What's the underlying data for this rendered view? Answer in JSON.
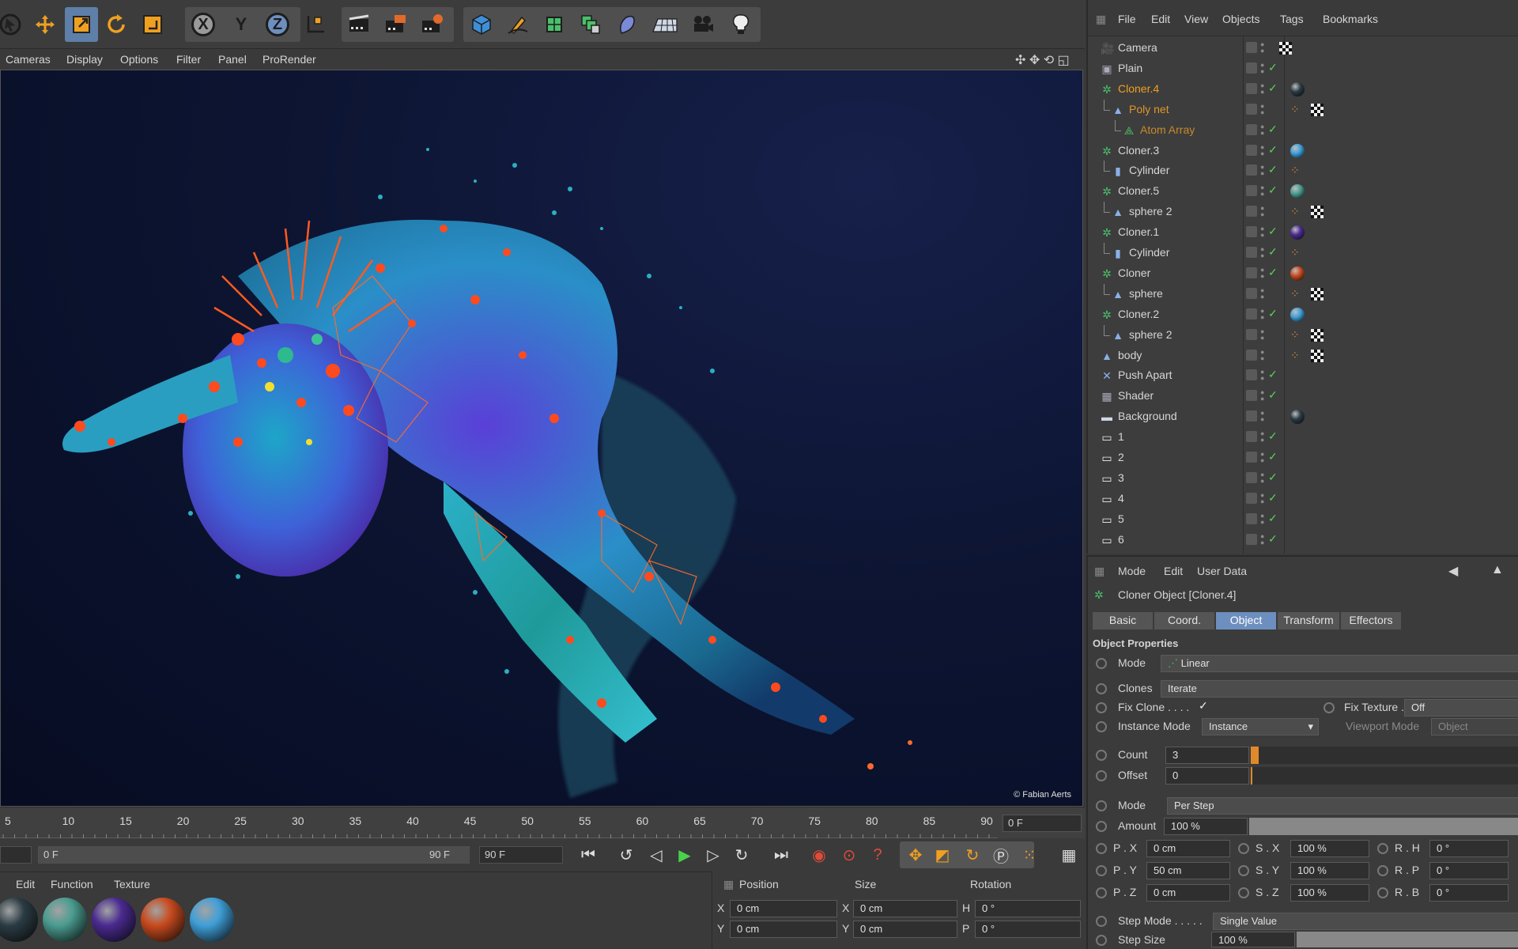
{
  "toolbar": {
    "icons": [
      "cursor-icon",
      "move-icon",
      "scale-icon",
      "rotate-icon",
      "last-tool-icon",
      "x-axis-icon",
      "y-axis-icon",
      "z-axis-icon",
      "world-coord-icon",
      "render-view-icon",
      "render-picture-viewer-icon",
      "render-settings-icon",
      "cube-icon",
      "pen-icon",
      "subdivision-icon",
      "array-icon",
      "deformer-icon",
      "floor-icon",
      "camera-icon",
      "light-icon"
    ],
    "axis_x": "X",
    "axis_y": "Y",
    "axis_z": "Z"
  },
  "viewport_menu": {
    "cameras": "Cameras",
    "display": "Display",
    "options": "Options",
    "filter": "Filter",
    "panel": "Panel",
    "prorender": "ProRender"
  },
  "viewport": {
    "credit": "© Fabian Aerts"
  },
  "timeline": {
    "ticks": [
      "5",
      "10",
      "15",
      "20",
      "25",
      "30",
      "35",
      "40",
      "45",
      "50",
      "55",
      "60",
      "65",
      "70",
      "75",
      "80",
      "85",
      "90"
    ],
    "current_frame": "0 F",
    "range_start": "0 F",
    "range_end": "90 F",
    "max_frame": "90 F"
  },
  "materials_menu": {
    "edit": "Edit",
    "function": "Function",
    "texture": "Texture"
  },
  "materials": [
    {
      "color": "#2b3c44"
    },
    {
      "color": "#4a9c90"
    },
    {
      "color": "#4a2a90"
    },
    {
      "color": "#c84a1e"
    },
    {
      "color": "#3f9fd8"
    }
  ],
  "coord": {
    "position": "Position",
    "size": "Size",
    "rotation": "Rotation",
    "px_label": "X",
    "px": "0 cm",
    "py_label": "Y",
    "py": "0 cm",
    "sx_label": "X",
    "sx": "0 cm",
    "sy_label": "Y",
    "sy": "0 cm",
    "rh_label": "H",
    "rh": "0 °",
    "rp_label": "P",
    "rp": "0 °"
  },
  "object_manager": {
    "menu": {
      "file": "File",
      "edit": "Edit",
      "view": "View",
      "objects": "Objects",
      "tags": "Tags",
      "bookmarks": "Bookmarks"
    },
    "rows": [
      {
        "name": "Camera",
        "indent": 0,
        "color": "#d6d6d6",
        "icon": "camera-icon",
        "tags": [
          "checker-small"
        ]
      },
      {
        "name": "Plain",
        "indent": 0,
        "color": "#d6d6d6",
        "icon": "plain-effector-icon",
        "tags": []
      },
      {
        "name": "Cloner.4",
        "indent": 0,
        "color": "#f0a020",
        "icon": "cloner-icon",
        "tags": [
          "sphere-dark"
        ]
      },
      {
        "name": "Poly net",
        "indent": 1,
        "color": "#e0962a",
        "icon": "polygon-icon",
        "tags": [
          "phong",
          "checker"
        ]
      },
      {
        "name": "Atom Array",
        "indent": 2,
        "color": "#c98a2a",
        "icon": "atom-array-icon",
        "tags": []
      },
      {
        "name": "Cloner.3",
        "indent": 0,
        "color": "#d6d6d6",
        "icon": "cloner-icon",
        "tags": [
          "sphere-blue"
        ]
      },
      {
        "name": "Cylinder",
        "indent": 1,
        "color": "#d6d6d6",
        "icon": "cylinder-icon",
        "tags": [
          "phong"
        ]
      },
      {
        "name": "Cloner.5",
        "indent": 0,
        "color": "#d6d6d6",
        "icon": "cloner-icon",
        "tags": [
          "sphere-teal"
        ]
      },
      {
        "name": "sphere 2",
        "indent": 1,
        "color": "#d6d6d6",
        "icon": "polygon-icon",
        "tags": [
          "phong",
          "checker"
        ]
      },
      {
        "name": "Cloner.1",
        "indent": 0,
        "color": "#d6d6d6",
        "icon": "cloner-icon",
        "tags": [
          "sphere-purple"
        ]
      },
      {
        "name": "Cylinder",
        "indent": 1,
        "color": "#d6d6d6",
        "icon": "cylinder-icon",
        "tags": [
          "phong"
        ]
      },
      {
        "name": "Cloner",
        "indent": 0,
        "color": "#d6d6d6",
        "icon": "cloner-icon",
        "tags": [
          "sphere-orange"
        ]
      },
      {
        "name": "sphere",
        "indent": 1,
        "color": "#d6d6d6",
        "icon": "polygon-icon",
        "tags": [
          "phong",
          "checker"
        ]
      },
      {
        "name": "Cloner.2",
        "indent": 0,
        "color": "#d6d6d6",
        "icon": "cloner-icon",
        "tags": [
          "sphere-blue"
        ]
      },
      {
        "name": "sphere 2",
        "indent": 1,
        "color": "#d6d6d6",
        "icon": "polygon-icon",
        "tags": [
          "phong",
          "checker"
        ]
      },
      {
        "name": "body",
        "indent": 0,
        "color": "#d6d6d6",
        "icon": "polygon-icon",
        "tags": [
          "phong",
          "checker"
        ]
      },
      {
        "name": "Push Apart",
        "indent": 0,
        "color": "#d6d6d6",
        "icon": "push-apart-icon",
        "tags": []
      },
      {
        "name": "Shader",
        "indent": 0,
        "color": "#d6d6d6",
        "icon": "shader-effector-icon",
        "tags": []
      },
      {
        "name": "Background",
        "indent": 0,
        "color": "#d6d6d6",
        "icon": "background-icon",
        "tags": [
          "sphere-dark"
        ]
      },
      {
        "name": "1",
        "indent": 0,
        "color": "#d6d6d6",
        "icon": "null-icon",
        "tags": []
      },
      {
        "name": "2",
        "indent": 0,
        "color": "#d6d6d6",
        "icon": "null-icon",
        "tags": []
      },
      {
        "name": "3",
        "indent": 0,
        "color": "#d6d6d6",
        "icon": "null-icon",
        "tags": []
      },
      {
        "name": "4",
        "indent": 0,
        "color": "#d6d6d6",
        "icon": "null-icon",
        "tags": []
      },
      {
        "name": "5",
        "indent": 0,
        "color": "#d6d6d6",
        "icon": "null-icon",
        "tags": []
      },
      {
        "name": "6",
        "indent": 0,
        "color": "#d6d6d6",
        "icon": "null-icon",
        "tags": []
      }
    ]
  },
  "attribute_manager": {
    "menu": {
      "mode": "Mode",
      "edit": "Edit",
      "user_data": "User Data"
    },
    "title": "Cloner Object [Cloner.4]",
    "tabs": [
      "Basic",
      "Coord.",
      "Object",
      "Transform",
      "Effectors"
    ],
    "active_tab": "Object",
    "section": "Object Properties",
    "mode_label": "Mode",
    "mode_value": "Linear",
    "clones_label": "Clones",
    "clones_value": "Iterate",
    "fix_clone_label": "Fix Clone . . . .",
    "fix_clone_value": "✓",
    "fix_texture_label": "Fix Texture . . . .",
    "fix_texture_value": "Off",
    "instance_mode_label": "Instance Mode",
    "instance_mode_value": "Instance",
    "viewport_mode_label": "Viewport Mode",
    "viewport_mode_value": "Object",
    "count_label": "Count",
    "count_value": "3",
    "offset_label": "Offset",
    "offset_value": "0",
    "mode2_label": "Mode",
    "mode2_value": "Per Step",
    "amount_label": "Amount",
    "amount_value": "100 %",
    "px_label": "P . X",
    "px_value": "0 cm",
    "py_label": "P . Y",
    "py_value": "50 cm",
    "pz_label": "P . Z",
    "pz_value": "0 cm",
    "sx_label": "S . X",
    "sx_value": "100 %",
    "sy_label": "S . Y",
    "sy_value": "100 %",
    "sz_label": "S . Z",
    "sz_value": "100 %",
    "rh_label": "R . H",
    "rh_value": "0 °",
    "rp_label": "R . P",
    "rp_value": "0 °",
    "rb_label": "R . B",
    "rb_value": "0 °",
    "step_mode_label": "Step Mode . . . . .",
    "step_mode_value": "Single Value",
    "step_size_label": "Step Size",
    "step_size_value": "100 %"
  }
}
